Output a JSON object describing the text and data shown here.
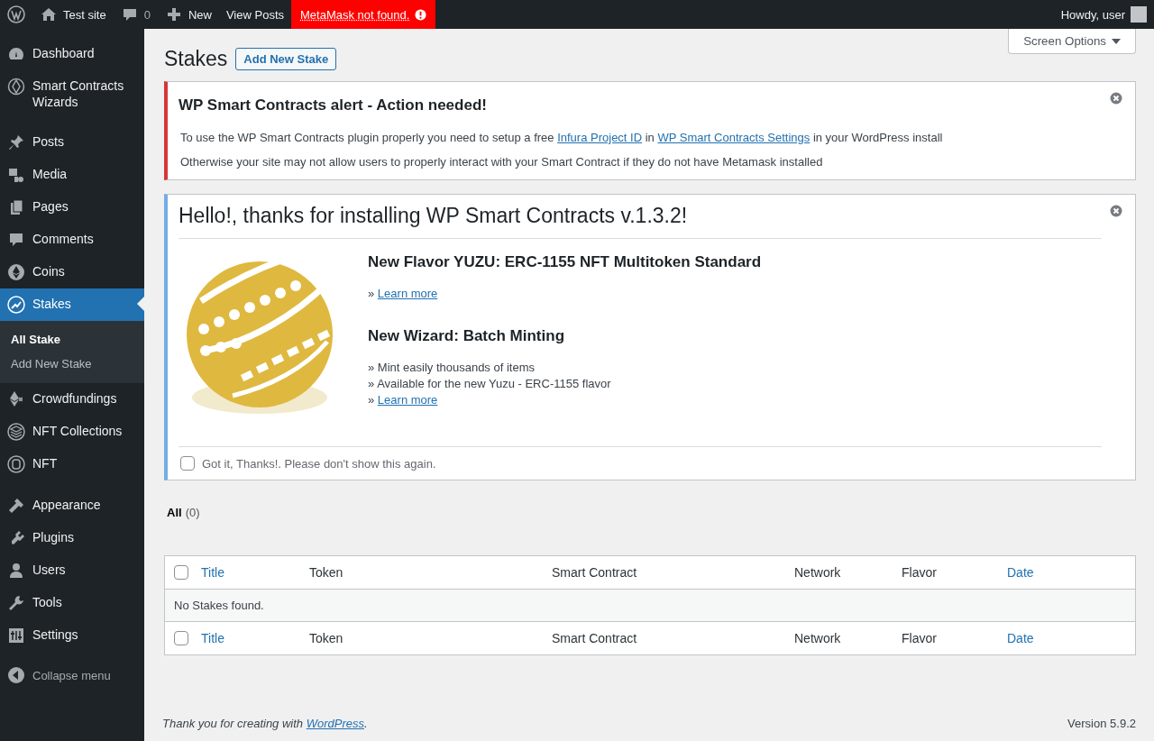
{
  "admin_bar": {
    "site": "Test site",
    "comments": "0",
    "new": "New",
    "view_posts": "View Posts",
    "alert": "MetaMask not found.",
    "greeting": "Howdy, user"
  },
  "sidebar": {
    "groups": [
      [
        {
          "label": "Dashboard",
          "selected": false
        },
        {
          "label": "Smart Contracts Wizards",
          "selected": false
        }
      ],
      [
        {
          "label": "Posts",
          "selected": false
        },
        {
          "label": "Media",
          "selected": false
        },
        {
          "label": "Pages",
          "selected": false
        },
        {
          "label": "Comments",
          "selected": false
        },
        {
          "label": "Coins",
          "selected": false
        },
        {
          "label": "Stakes",
          "selected": true,
          "children": [
            {
              "label": "All Stake",
              "selected": true
            },
            {
              "label": "Add New Stake",
              "selected": false
            }
          ]
        },
        {
          "label": "Crowdfundings",
          "selected": false
        },
        {
          "label": "NFT Collections",
          "selected": false
        },
        {
          "label": "NFT",
          "selected": false
        }
      ],
      [
        {
          "label": "Appearance",
          "selected": false
        },
        {
          "label": "Plugins",
          "selected": false
        },
        {
          "label": "Users",
          "selected": false
        },
        {
          "label": "Tools",
          "selected": false
        },
        {
          "label": "Settings",
          "selected": false
        }
      ]
    ],
    "collapse": "Collapse menu"
  },
  "screen_options": "Screen Options",
  "page_title": "Stakes",
  "add_button": "Add New Stake",
  "alert": {
    "title": "WP Smart Contracts alert - Action needed!",
    "line1": {
      "before": "To use the WP Smart Contracts plugin properly you need to setup a free ",
      "link1": "Infura Project ID",
      "middle": " in ",
      "link2": "WP Smart Contracts Settings",
      "after": " in your WordPress install"
    },
    "line2": "Otherwise your site may not allow users to properly interact with your Smart Contract if they do not have Metamask installed"
  },
  "welcome": {
    "title": "Hello!, thanks for installing WP Smart Contracts v.1.3.2!",
    "sections": [
      {
        "heading": "New Flavor YUZU: ERC-1155 NFT Multitoken Standard",
        "bullets": [
          {
            "marker": "»",
            "text": "Learn more",
            "kind": "link"
          }
        ]
      },
      {
        "heading": "New Wizard: Batch Minting",
        "bullets": [
          {
            "marker": "»",
            "text": "Mint easily thousands of items",
            "kind": "text"
          },
          {
            "marker": "»",
            "text": "Available for the new Yuzu - ERC-1155 flavor",
            "kind": "text"
          },
          {
            "marker": "»",
            "text": "Learn more",
            "kind": "link"
          }
        ]
      }
    ],
    "dismiss": {
      "label": "Got it, Thanks!. Please don't show this again.",
      "checked": false
    }
  },
  "filters": [
    {
      "label": "All",
      "count": "(0)",
      "selected": true
    }
  ],
  "table": {
    "columns": [
      {
        "label": "Title",
        "kind": "link"
      },
      {
        "label": "Token",
        "kind": "text"
      },
      {
        "label": "Smart Contract",
        "kind": "text"
      },
      {
        "label": "Network",
        "kind": "text"
      },
      {
        "label": "Flavor",
        "kind": "text"
      },
      {
        "label": "Date",
        "kind": "link"
      }
    ],
    "footer_columns": [
      {
        "label": "Title",
        "kind": "link"
      },
      {
        "label": "Token",
        "kind": "text"
      },
      {
        "label": "Smart Contract",
        "kind": "text"
      },
      {
        "label": "Network",
        "kind": "text"
      },
      {
        "label": "Flavor",
        "kind": "text"
      },
      {
        "label": "Date",
        "kind": "link"
      }
    ],
    "select_all_bottom_checked": false,
    "empty": "No Stakes found.",
    "select_all_checked": false
  },
  "footer": {
    "before": "Thank you for creating with ",
    "link": "WordPress",
    "after": ".",
    "version": "Version 5.9.2"
  }
}
